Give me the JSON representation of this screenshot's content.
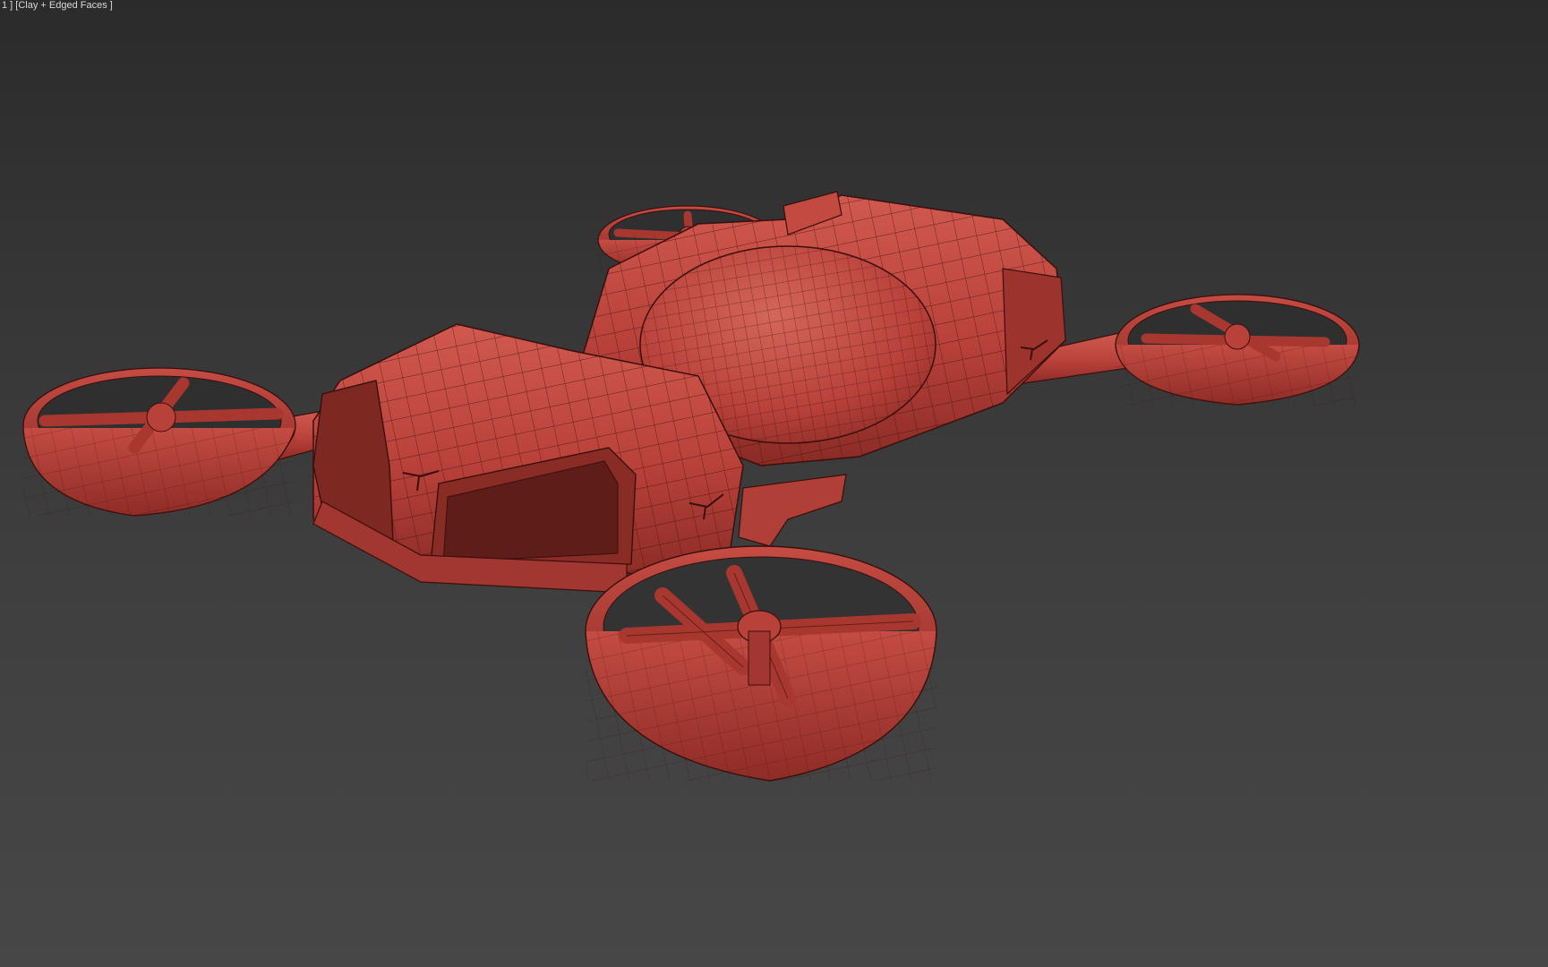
{
  "viewport": {
    "label_prefix": "1 ] [",
    "shading_mode": "Clay + Edged Faces",
    "label_suffix": " ]"
  },
  "colors": {
    "clay": "#b8413a",
    "clay_light": "#d0594f",
    "clay_dark": "#7a2622",
    "edge": "#3a0f0c",
    "background_top": "#2b2b2b",
    "background_bottom": "#474747"
  }
}
